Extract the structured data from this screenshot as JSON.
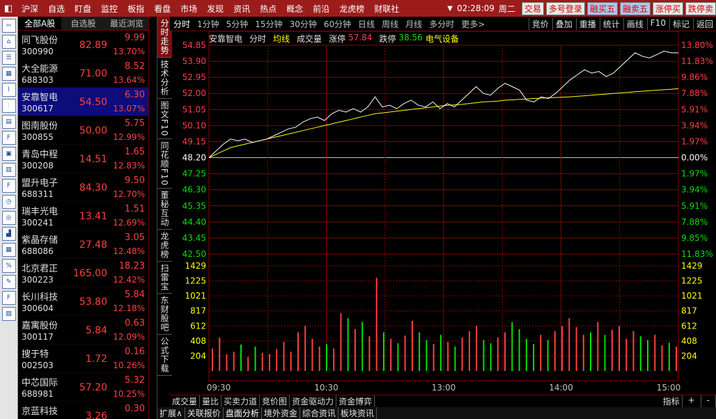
{
  "topbar": {
    "menu": [
      "沪深",
      "自选",
      "盯盘",
      "监控",
      "板指",
      "看盘",
      "市场",
      "发现",
      "资讯",
      "热点",
      "概念",
      "前沿",
      "龙虎榜",
      "财联社"
    ],
    "time": "02:28:09",
    "weekday": "周二",
    "right_buttons": [
      "交易",
      "多号登录",
      "融买五",
      "融卖五",
      "涨停买",
      "跌停卖"
    ]
  },
  "stocklist": {
    "tabs": [
      "全部A股",
      "自选股",
      "最近浏览"
    ],
    "rows": [
      {
        "name": "同飞股份",
        "code": "300990",
        "price": "82.89",
        "chg": "9.99",
        "pct": "13.70%"
      },
      {
        "name": "大全能源",
        "code": "688303",
        "price": "71.00",
        "chg": "8.52",
        "pct": "13.64%"
      },
      {
        "name": "安靠智电",
        "code": "300617",
        "price": "54.50",
        "chg": "6.30",
        "pct": "13.07%"
      },
      {
        "name": "图南股份",
        "code": "300855",
        "price": "50.00",
        "chg": "5.75",
        "pct": "12.99%"
      },
      {
        "name": "青岛中程",
        "code": "300208",
        "price": "14.51",
        "chg": "1.65",
        "pct": "12.83%"
      },
      {
        "name": "盟升电子",
        "code": "688311",
        "price": "84.30",
        "chg": "9.50",
        "pct": "12.70%"
      },
      {
        "name": "瑞丰光电",
        "code": "300241",
        "price": "13.41",
        "chg": "1.51",
        "pct": "12.69%"
      },
      {
        "name": "紫晶存储",
        "code": "688086",
        "price": "27.48",
        "chg": "3.05",
        "pct": "12.48%"
      },
      {
        "name": "北京君正",
        "code": "300223",
        "price": "165.00",
        "chg": "18.23",
        "pct": "12.42%"
      },
      {
        "name": "长川科技",
        "code": "300604",
        "price": "53.80",
        "chg": "5.84",
        "pct": "12.18%"
      },
      {
        "name": "嘉寓股份",
        "code": "300117",
        "price": "5.84",
        "chg": "0.63",
        "pct": "12.09%"
      },
      {
        "name": "搜于特",
        "code": "002503",
        "price": "1.72",
        "chg": "0.16",
        "pct": "10.26%"
      },
      {
        "name": "中芯国际",
        "code": "688981",
        "price": "57.20",
        "chg": "5.32",
        "pct": "10.25%"
      },
      {
        "name": "京蓝科技",
        "code": "",
        "price": "3.26",
        "chg": "0.30",
        "pct": ""
      }
    ]
  },
  "vtabs": [
    "分时走势",
    "技术分析",
    "图文F10",
    "同花顺F10",
    "董秘互动",
    "龙虎榜",
    "扫雷宝",
    "东财股吧",
    "公式下载"
  ],
  "charttools": {
    "periods": [
      "分时",
      "1分钟",
      "5分钟",
      "15分钟",
      "30分钟",
      "60分钟",
      "日线",
      "周线",
      "月线",
      "多分时",
      "更多>"
    ],
    "right": [
      "竞价",
      "叠加",
      "重播",
      "统计",
      "画线",
      "F10",
      "标记",
      "返回"
    ]
  },
  "chart_info": {
    "stock": "安靠智电",
    "mode": "分时",
    "avg": "均线",
    "vol": "成交量",
    "limit_up_label": "涨停",
    "limit_up": "57.84",
    "limit_down_label": "跌停",
    "limit_down": "38.56",
    "sector": "电气设备"
  },
  "chart_data": {
    "type": "line",
    "title": "",
    "price_ticks": [
      "54.85",
      "53.90",
      "52.95",
      "52.00",
      "51.05",
      "50.10",
      "49.15",
      "48.20",
      "47.25",
      "46.30",
      "45.35",
      "44.40",
      "43.45",
      "42.50"
    ],
    "pct_ticks": [
      "13.80%",
      "11.83%",
      "9.86%",
      "7.88%",
      "5.91%",
      "3.94%",
      "1.97%",
      "0.00%",
      "1.97%",
      "3.94%",
      "5.91%",
      "7.88%",
      "9.85%",
      "11.83%"
    ],
    "vol_ticks": [
      "1429",
      "1225",
      "1021",
      "817",
      "612",
      "408",
      "204"
    ],
    "time_ticks": [
      "09:30",
      "10:30",
      "13:00",
      "14:00",
      "15:00"
    ],
    "prev_close": 48.2,
    "ylim": [
      42.5,
      54.85
    ],
    "price_series": [
      48.2,
      48.6,
      49.0,
      49.3,
      49.2,
      49.3,
      49.1,
      49.2,
      49.3,
      49.5,
      49.7,
      49.9,
      50.0,
      50.3,
      50.5,
      50.6,
      50.4,
      50.8,
      51.0,
      50.9,
      51.1,
      50.9,
      51.2,
      51.8,
      51.2,
      51.3,
      51.1,
      51.4,
      51.6,
      51.3,
      51.2,
      51.5,
      51.1,
      51.4,
      51.2,
      51.6,
      52.0,
      52.4,
      52.0,
      51.9,
      52.3,
      52.6,
      52.4,
      52.2,
      51.6,
      51.5,
      51.8,
      51.7,
      52.0,
      52.4,
      52.8,
      53.1,
      53.4,
      53.2,
      53.3,
      53.0,
      53.2,
      53.6,
      54.0,
      54.4,
      54.2,
      54.1,
      54.3,
      54.5,
      54.4,
      54.4
    ],
    "avg_series": [
      48.2,
      48.4,
      48.6,
      48.8,
      48.9,
      49.0,
      49.1,
      49.2,
      49.3,
      49.4,
      49.5,
      49.6,
      49.7,
      49.8,
      49.9,
      50.0,
      50.1,
      50.2,
      50.3,
      50.4,
      50.5,
      50.6,
      50.7,
      50.8,
      50.85,
      50.9,
      50.95,
      51.0,
      51.05,
      51.1,
      51.15,
      51.2,
      51.25,
      51.3,
      51.32,
      51.35,
      51.4,
      51.45,
      51.5,
      51.52,
      51.55,
      51.6,
      51.62,
      51.65,
      51.67,
      51.7,
      51.72,
      51.74,
      51.76,
      51.78,
      51.8,
      51.83,
      51.86,
      51.9,
      51.93,
      51.96,
      52.0,
      52.03,
      52.06,
      52.1,
      52.13,
      52.16,
      52.19,
      52.22,
      52.25,
      52.28
    ],
    "volume_series": [
      350,
      520,
      260,
      300,
      410,
      220,
      380,
      280,
      260,
      340,
      450,
      300,
      600,
      700,
      500,
      380,
      420,
      350,
      900,
      820,
      650,
      760,
      540,
      1450,
      600,
      500,
      430,
      550,
      780,
      600,
      480,
      420,
      560,
      450,
      380,
      520,
      620,
      700,
      480,
      430,
      520,
      600,
      760,
      650,
      500,
      420,
      560,
      480,
      620,
      700,
      820,
      680,
      560,
      600,
      760,
      560,
      640,
      700,
      500,
      620,
      540,
      480,
      560,
      400,
      440,
      380
    ]
  },
  "subtabs": [
    "成交量",
    "量比",
    "买卖力道",
    "竞价图",
    "资金驱动力",
    "资金博弈"
  ],
  "subtabs_right": [
    "指标",
    "+",
    "-"
  ],
  "bottomtabs": [
    "扩展∧",
    "关联报价",
    "盘面分析",
    "境外资金",
    "综合资讯",
    "板块资讯"
  ],
  "colors": {
    "up": "#ff4040",
    "down": "#00e000",
    "grid": "#8a0000",
    "price": "#ffffff",
    "avg": "#ffff00",
    "accent": "#9c1c1c"
  }
}
